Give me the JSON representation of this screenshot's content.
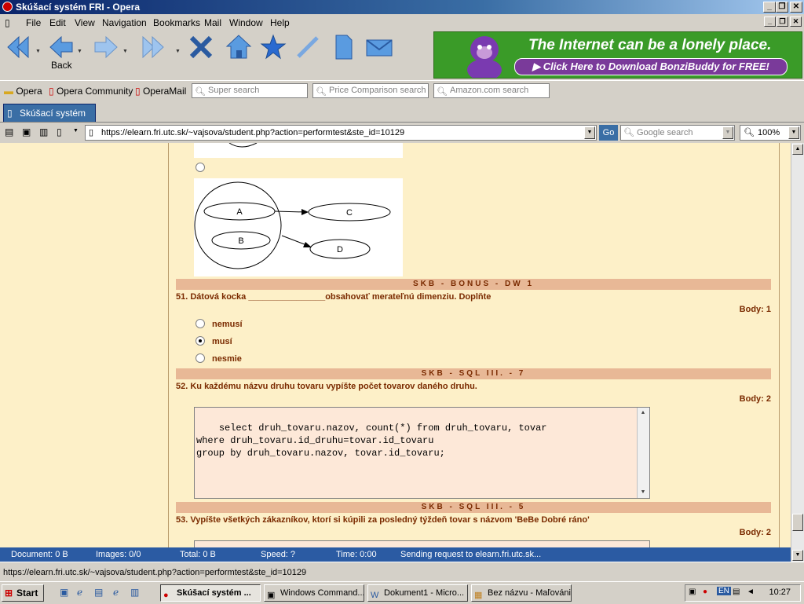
{
  "window": {
    "title": "Skúšací systém FRI - Opera"
  },
  "menu": [
    "File",
    "Edit",
    "View",
    "Navigation",
    "Bookmarks",
    "Mail",
    "Window",
    "Help"
  ],
  "toolbar": {
    "back_label": "Back"
  },
  "banner": {
    "headline": "The Internet can be a lonely place.",
    "cta": "▶ Click Here to Download BonziBuddy for FREE!"
  },
  "personal_bar": {
    "items": [
      "Opera",
      "Opera Community",
      "OperaMail"
    ],
    "searches": [
      "Super search",
      "Price Comparison search",
      "Amazon.com search"
    ]
  },
  "tab": {
    "label": "Skúšací systém FRI"
  },
  "address": {
    "url": "https://elearn.fri.utc.sk/~vajsova/student.php?action=performtest&ste_id=10129",
    "go_label": "Go",
    "search_placeholder": "Google search",
    "zoom": "100%"
  },
  "diagram": {
    "nodes": [
      "A",
      "B",
      "C",
      "D"
    ]
  },
  "q51": {
    "section": "SKB - BONUS - DW 1",
    "text": "51. Dátová kocka ________________obsahovať merateľnú dimenziu. Doplňte",
    "points": "Body: 1",
    "options": [
      "nemusí",
      "musí",
      "nesmie"
    ],
    "selected": 1
  },
  "q52": {
    "section": "SKB - SQL III. - 7",
    "text": "52. Ku každému názvu druhu tovaru vypíšte počet tovarov daného druhu.",
    "points": "Body: 2",
    "answer": "select druh_tovaru.nazov, count(*) from druh_tovaru, tovar\nwhere druh_tovaru.id_druhu=tovar.id_tovaru\ngroup by druh_tovaru.nazov, tovar.id_tovaru;"
  },
  "q53": {
    "section": "SKB - SQL III. - 5",
    "text": "53. Vypíšte všetkých zákazníkov, ktorí si kúpili za posledný týždeň tovar s názvom 'BeBe Dobré ráno'",
    "points": "Body: 2"
  },
  "status": {
    "document": "Document:   0 B",
    "images": "Images:   0/0",
    "total": "Total:   0 B",
    "speed": "Speed:   ?",
    "time": "Time:   0:00",
    "message": "Sending request to elearn.fri.utc.sk..."
  },
  "url_status": "https://elearn.fri.utc.sk/~vajsova/student.php?action=performtest&ste_id=10129",
  "taskbar": {
    "start": "Start",
    "tasks": [
      "Skúšací systém ...",
      "Windows Command...",
      "Dokument1 - Micro...",
      "Bez názvu - Maľovánі"
    ],
    "tray_lang": "EN",
    "clock": "10:27"
  },
  "colors": {
    "page_bg": "#fdf0c8",
    "section_bar": "#e8b896",
    "question_text": "#7a2a00",
    "statusbar": "#2b5ba3"
  }
}
